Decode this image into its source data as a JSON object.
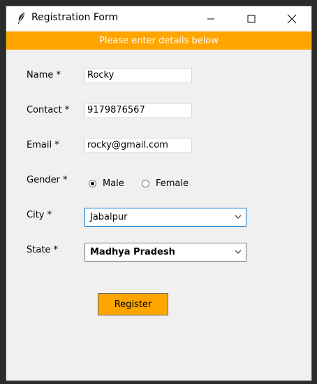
{
  "window": {
    "title": "Registration Form",
    "banner": "Please enter details below"
  },
  "fields": {
    "name": {
      "label": "Name *",
      "value": "Rocky"
    },
    "contact": {
      "label": "Contact *",
      "value": "9179876567"
    },
    "email": {
      "label": "Email *",
      "value": "rocky@gmail.com"
    },
    "gender": {
      "label": "Gender *",
      "options": [
        "Male",
        "Female"
      ],
      "selected": "Male"
    },
    "city": {
      "label": "City *",
      "value": "Jabalpur"
    },
    "state": {
      "label": "State *",
      "value": "Madhya Pradesh"
    }
  },
  "actions": {
    "register_label": "Register"
  },
  "colors": {
    "accent": "#ffa500",
    "banner_text": "#ffffff",
    "focus_border": "#0078d7"
  },
  "icons": {
    "app": "feather-icon",
    "minimize": "minimize-icon",
    "maximize": "maximize-icon",
    "close": "close-icon",
    "dropdown": "chevron-down-icon"
  }
}
